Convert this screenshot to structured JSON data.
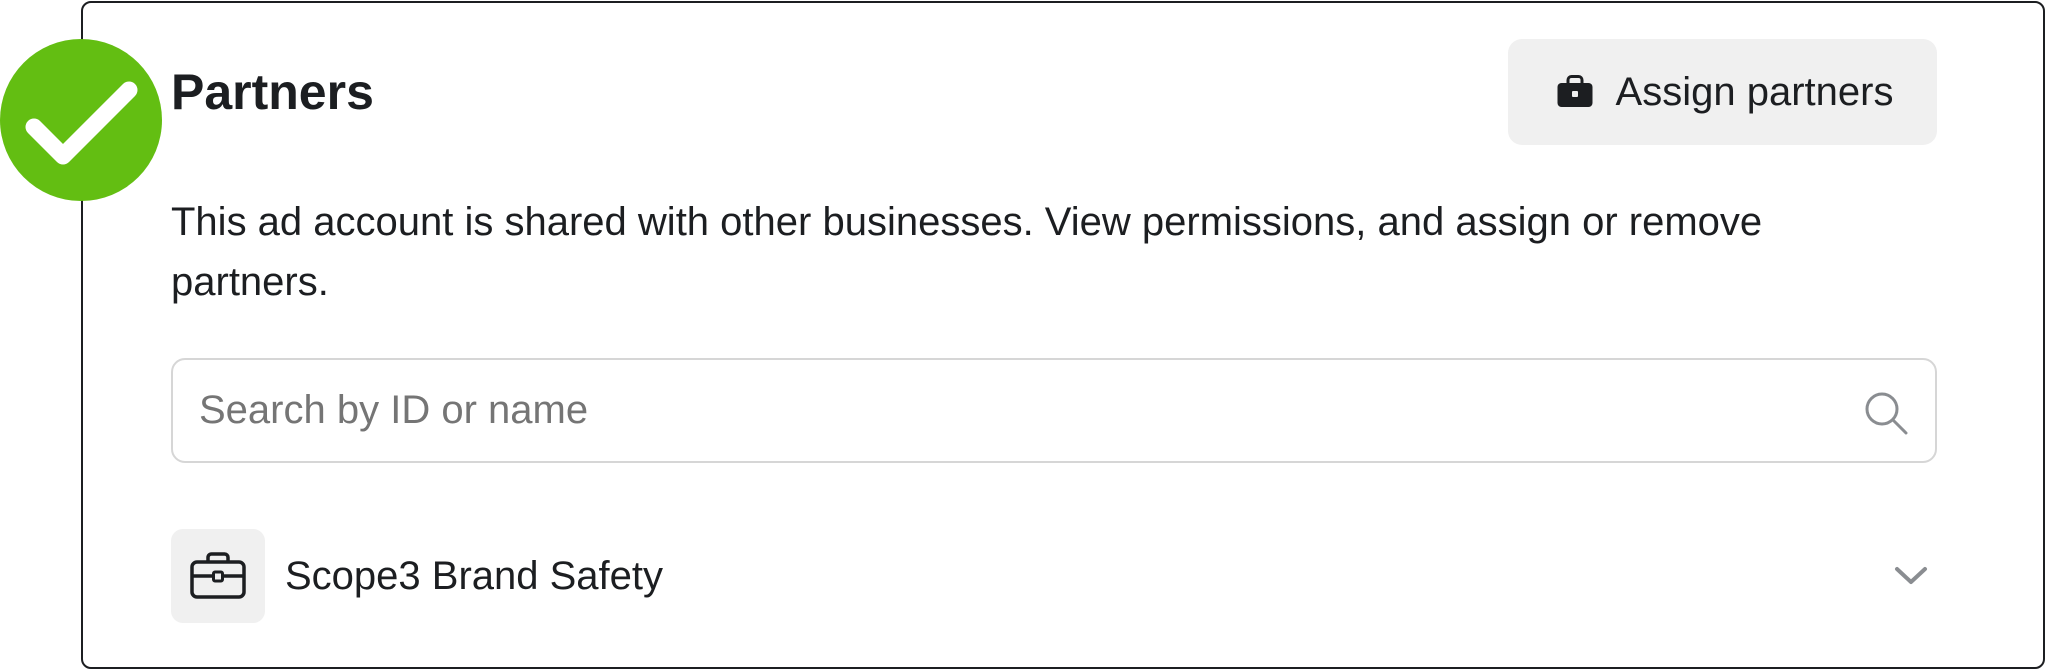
{
  "status": {
    "icon": "checkmark-icon",
    "color": "#63be12"
  },
  "section": {
    "title": "Partners",
    "description": "This ad account is shared with other businesses. View permissions, and assign or remove partners."
  },
  "actions": {
    "assign_label": "Assign partners",
    "assign_icon": "briefcase-icon"
  },
  "search": {
    "placeholder": "Search by ID or name",
    "value": "",
    "icon": "search-icon"
  },
  "partners": [
    {
      "name": "Scope3 Brand Safety",
      "icon": "briefcase-icon",
      "expand_icon": "chevron-down-icon"
    }
  ]
}
